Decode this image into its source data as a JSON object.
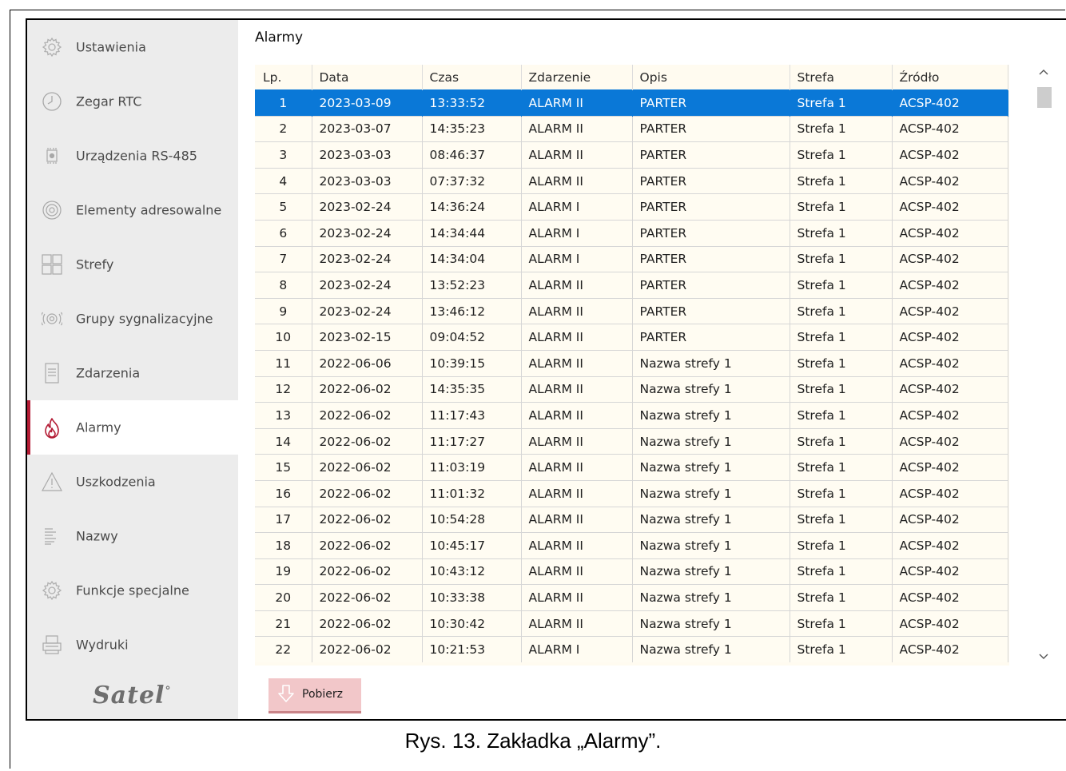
{
  "sidebar": {
    "items": [
      {
        "label": "Ustawienia",
        "icon": "gear-icon"
      },
      {
        "label": "Zegar RTC",
        "icon": "clock-icon"
      },
      {
        "label": "Urządzenia RS-485",
        "icon": "device-icon"
      },
      {
        "label": "Elementy adresowalne",
        "icon": "detector-icon"
      },
      {
        "label": "Strefy",
        "icon": "zones-grid-icon"
      },
      {
        "label": "Grupy sygnalizacyjne",
        "icon": "siren-icon"
      },
      {
        "label": "Zdarzenia",
        "icon": "document-icon"
      },
      {
        "label": "Alarmy",
        "icon": "flame-icon",
        "active": true
      },
      {
        "label": "Uszkodzenia",
        "icon": "warning-icon"
      },
      {
        "label": "Nazwy",
        "icon": "list-icon"
      },
      {
        "label": "Funkcje specjalne",
        "icon": "gear-icon"
      },
      {
        "label": "Wydruki",
        "icon": "printer-icon"
      }
    ],
    "logo": "Satel"
  },
  "main": {
    "title": "Alarmy",
    "table": {
      "headers": [
        "Lp.",
        "Data",
        "Czas",
        "Zdarzenie",
        "Opis",
        "Strefa",
        "Źródło"
      ],
      "rows": [
        [
          "1",
          "2023-03-09",
          "13:33:52",
          "ALARM II",
          "PARTER",
          "Strefa 1",
          "ACSP-402"
        ],
        [
          "2",
          "2023-03-07",
          "14:35:23",
          "ALARM II",
          "PARTER",
          "Strefa 1",
          "ACSP-402"
        ],
        [
          "3",
          "2023-03-03",
          "08:46:37",
          "ALARM II",
          "PARTER",
          "Strefa 1",
          "ACSP-402"
        ],
        [
          "4",
          "2023-03-03",
          "07:37:32",
          "ALARM II",
          "PARTER",
          "Strefa 1",
          "ACSP-402"
        ],
        [
          "5",
          "2023-02-24",
          "14:36:24",
          "ALARM I",
          "PARTER",
          "Strefa 1",
          "ACSP-402"
        ],
        [
          "6",
          "2023-02-24",
          "14:34:44",
          "ALARM I",
          "PARTER",
          "Strefa 1",
          "ACSP-402"
        ],
        [
          "7",
          "2023-02-24",
          "14:34:04",
          "ALARM I",
          "PARTER",
          "Strefa 1",
          "ACSP-402"
        ],
        [
          "8",
          "2023-02-24",
          "13:52:23",
          "ALARM II",
          "PARTER",
          "Strefa 1",
          "ACSP-402"
        ],
        [
          "9",
          "2023-02-24",
          "13:46:12",
          "ALARM II",
          "PARTER",
          "Strefa 1",
          "ACSP-402"
        ],
        [
          "10",
          "2023-02-15",
          "09:04:52",
          "ALARM II",
          "PARTER",
          "Strefa 1",
          "ACSP-402"
        ],
        [
          "11",
          "2022-06-06",
          "10:39:15",
          "ALARM II",
          "Nazwa strefy 1",
          "Strefa 1",
          "ACSP-402"
        ],
        [
          "12",
          "2022-06-02",
          "14:35:35",
          "ALARM II",
          "Nazwa strefy 1",
          "Strefa 1",
          "ACSP-402"
        ],
        [
          "13",
          "2022-06-02",
          "11:17:43",
          "ALARM II",
          "Nazwa strefy 1",
          "Strefa 1",
          "ACSP-402"
        ],
        [
          "14",
          "2022-06-02",
          "11:17:27",
          "ALARM II",
          "Nazwa strefy 1",
          "Strefa 1",
          "ACSP-402"
        ],
        [
          "15",
          "2022-06-02",
          "11:03:19",
          "ALARM II",
          "Nazwa strefy 1",
          "Strefa 1",
          "ACSP-402"
        ],
        [
          "16",
          "2022-06-02",
          "11:01:32",
          "ALARM II",
          "Nazwa strefy 1",
          "Strefa 1",
          "ACSP-402"
        ],
        [
          "17",
          "2022-06-02",
          "10:54:28",
          "ALARM II",
          "Nazwa strefy 1",
          "Strefa 1",
          "ACSP-402"
        ],
        [
          "18",
          "2022-06-02",
          "10:45:17",
          "ALARM II",
          "Nazwa strefy 1",
          "Strefa 1",
          "ACSP-402"
        ],
        [
          "19",
          "2022-06-02",
          "10:43:12",
          "ALARM II",
          "Nazwa strefy 1",
          "Strefa 1",
          "ACSP-402"
        ],
        [
          "20",
          "2022-06-02",
          "10:33:38",
          "ALARM II",
          "Nazwa strefy 1",
          "Strefa 1",
          "ACSP-402"
        ],
        [
          "21",
          "2022-06-02",
          "10:30:42",
          "ALARM II",
          "Nazwa strefy 1",
          "Strefa 1",
          "ACSP-402"
        ],
        [
          "22",
          "2022-06-02",
          "10:21:53",
          "ALARM I",
          "Nazwa strefy 1",
          "Strefa 1",
          "ACSP-402"
        ]
      ],
      "selected_row": 0
    },
    "download_button": {
      "label": "Pobierz",
      "icon": "download-arrow-icon"
    }
  },
  "caption": "Rys. 13. Zakładka „Alarmy”.",
  "colors": {
    "accent": "#b31b34",
    "selection": "#0a78d7",
    "sidebar_bg": "#ececec",
    "table_bg": "#fffbf0",
    "button_bg": "#f2c7c9"
  }
}
